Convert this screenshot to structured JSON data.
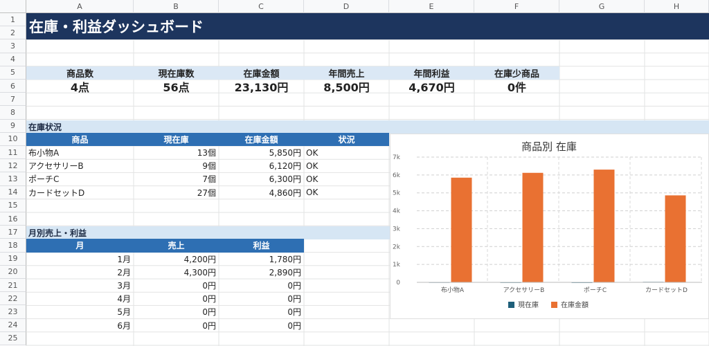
{
  "columns": [
    "A",
    "B",
    "C",
    "D",
    "E",
    "F",
    "G",
    "H"
  ],
  "rows": [
    "1",
    "2",
    "3",
    "4",
    "5",
    "6",
    "7",
    "8",
    "9",
    "10",
    "11",
    "12",
    "13",
    "14",
    "15",
    "16",
    "17",
    "18",
    "19",
    "20",
    "21",
    "22",
    "23",
    "24",
    "25"
  ],
  "title": "在庫・利益ダッシュボード",
  "kpis": [
    {
      "label": "商品数",
      "value": "4点"
    },
    {
      "label": "現在庫数",
      "value": "56点"
    },
    {
      "label": "在庫金額",
      "value": "23,130円"
    },
    {
      "label": "年間売上",
      "value": "8,500円"
    },
    {
      "label": "年間利益",
      "value": "4,670円"
    },
    {
      "label": "在庫少商品",
      "value": "0件"
    }
  ],
  "inventory": {
    "section_title": "在庫状況",
    "headers": [
      "商品",
      "現在庫",
      "在庫金額",
      "状況"
    ],
    "rows": [
      [
        "布小物A",
        "13個",
        "5,850円",
        "OK"
      ],
      [
        "アクセサリーB",
        "9個",
        "6,120円",
        "OK"
      ],
      [
        "ポーチC",
        "7個",
        "6,300円",
        "OK"
      ],
      [
        "カードセットD",
        "27個",
        "4,860円",
        "OK"
      ]
    ]
  },
  "monthly": {
    "section_title": "月別売上・利益",
    "headers": [
      "月",
      "売上",
      "利益"
    ],
    "rows": [
      [
        "1月",
        "4,200円",
        "1,780円"
      ],
      [
        "2月",
        "4,300円",
        "2,890円"
      ],
      [
        "3月",
        "0円",
        "0円"
      ],
      [
        "4月",
        "0円",
        "0円"
      ],
      [
        "5月",
        "0円",
        "0円"
      ],
      [
        "6月",
        "0円",
        "0円"
      ]
    ]
  },
  "colors": {
    "title_bg": "#1d355e",
    "header_bg": "#2e6fb3",
    "kpi_bg": "#dbe8f5",
    "stock": "#1f5f7a",
    "value": "#e97132"
  },
  "chart_data": {
    "type": "bar",
    "title": "商品別 在庫",
    "categories": [
      "布小物A",
      "アクセサリーB",
      "ポーチC",
      "カードセットD"
    ],
    "series": [
      {
        "name": "現在庫",
        "values": [
          13,
          9,
          7,
          27
        ]
      },
      {
        "name": "在庫金額",
        "values": [
          5850,
          6120,
          6300,
          4860
        ]
      }
    ],
    "ylim": [
      0,
      7000
    ],
    "yticks": [
      "0",
      "1k",
      "2k",
      "3k",
      "4k",
      "5k",
      "6k",
      "7k"
    ],
    "grid": true,
    "legend": "bottom"
  }
}
